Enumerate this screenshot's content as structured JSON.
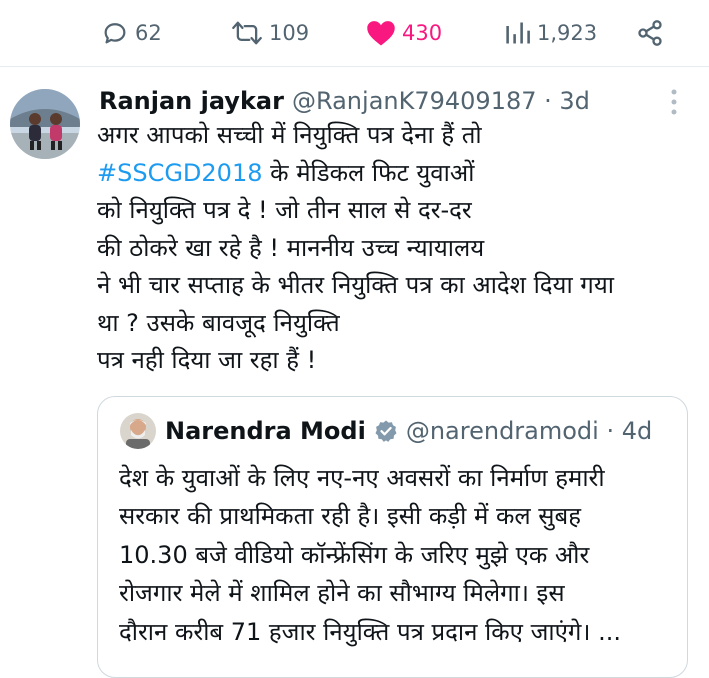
{
  "actions": {
    "replies": "62",
    "retweets": "109",
    "likes": "430",
    "views": "1,923"
  },
  "colors": {
    "like_active": "#f91880",
    "hashtag": "#1d9bf0",
    "secondary_text": "#536471",
    "verified_badge": "#829aab"
  },
  "reply_tweet": {
    "author_name": "Ranjan jaykar",
    "handle_time": "@RanjanK79409187 · 3d",
    "line1": "अगर आपको सच्ची में नियुक्ति पत्र देना हैं तो",
    "hashtag": "#SSCGD2018",
    "line2_rest": " के मेडिकल फिट युवाओं",
    "line3": "को नियुक्ति पत्र दे ! जो तीन साल से दर-दर",
    "line4": "की ठोकरे खा रहे है ! माननीय उच्च न्यायालय",
    "line5": "ने भी चार सप्ताह के भीतर नियुक्ति पत्र का आदेश दिया गया",
    "line6": "था ? उसके बावजूद नियुक्ति",
    "line7": "पत्र नही दिया जा रहा हैं !"
  },
  "quoted_tweet": {
    "author_name": "Narendra Modi",
    "handle_time": "@narendramodi · 4d",
    "line1": "देश के युवाओं के लिए नए-नए अवसरों का निर्माण हमारी",
    "line2": "सरकार की प्राथमिकता रही है। इसी कड़ी में कल सुबह",
    "line3": "10.30 बजे वीडियो कॉन्फ्रेंसिंग के जरिए मुझे एक और",
    "line4": "रोजगार मेले में शामिल होने का सौभाग्य मिलेगा। इस",
    "line5": "दौरान करीब 71 हजार नियुक्ति पत्र प्रदान किए जाएंगे। ..."
  },
  "icons": [
    "reply-icon",
    "retweet-icon",
    "like-icon",
    "views-icon",
    "share-icon",
    "more-icon",
    "verified-icon"
  ]
}
